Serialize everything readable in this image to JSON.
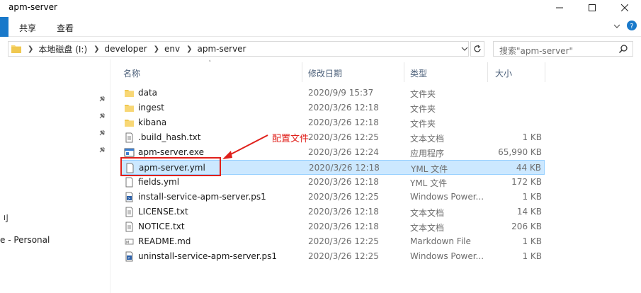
{
  "window": {
    "title": "apm-server"
  },
  "ribbon": {
    "tabs": [
      "共享",
      "查看"
    ]
  },
  "address": {
    "crumbs": [
      "本地磁盘 (I:)",
      "developer",
      "env",
      "apm-server"
    ]
  },
  "search": {
    "placeholder": "搜索\"apm-server\""
  },
  "nav": {
    "fragment_1": "刂",
    "fragment_2": "e - Personal"
  },
  "columns": {
    "name": "名称",
    "date": "修改日期",
    "type": "类型",
    "size": "大小"
  },
  "files": [
    {
      "name": "data",
      "date": "2020/9/9 15:37",
      "type": "文件夹",
      "size": "",
      "icon": "folder-icon"
    },
    {
      "name": "ingest",
      "date": "2020/3/26 12:18",
      "type": "文件夹",
      "size": "",
      "icon": "folder-icon"
    },
    {
      "name": "kibana",
      "date": "2020/3/26 12:18",
      "type": "文件夹",
      "size": "",
      "icon": "folder-icon"
    },
    {
      "name": ".build_hash.txt",
      "date": "2020/3/26 12:25",
      "type": "文本文档",
      "size": "1 KB",
      "icon": "text-file-icon"
    },
    {
      "name": "apm-server.exe",
      "date": "2020/3/26 12:24",
      "type": "应用程序",
      "size": "65,990 KB",
      "icon": "exe-file-icon"
    },
    {
      "name": "apm-server.yml",
      "date": "2020/3/26 12:18",
      "type": "YML 文件",
      "size": "44 KB",
      "icon": "blank-file-icon",
      "selected": true
    },
    {
      "name": "fields.yml",
      "date": "2020/3/26 12:18",
      "type": "YML 文件",
      "size": "172 KB",
      "icon": "blank-file-icon"
    },
    {
      "name": "install-service-apm-server.ps1",
      "date": "2020/3/26 12:25",
      "type": "Windows Power...",
      "size": "1 KB",
      "icon": "powershell-file-icon"
    },
    {
      "name": "LICENSE.txt",
      "date": "2020/3/26 12:18",
      "type": "文本文档",
      "size": "14 KB",
      "icon": "text-file-icon"
    },
    {
      "name": "NOTICE.txt",
      "date": "2020/3/26 12:18",
      "type": "文本文档",
      "size": "206 KB",
      "icon": "text-file-icon"
    },
    {
      "name": "README.md",
      "date": "2020/3/26 12:25",
      "type": "Markdown File",
      "size": "1 KB",
      "icon": "markdown-file-icon"
    },
    {
      "name": "uninstall-service-apm-server.ps1",
      "date": "2020/3/26 12:25",
      "type": "Windows Power...",
      "size": "1 KB",
      "icon": "powershell-file-icon"
    }
  ],
  "annotation": {
    "label": "配置文件",
    "color": "#e0201b"
  },
  "colors": {
    "selection": "#cce8ff",
    "folder": "#f8d775",
    "accent": "#1979ca"
  }
}
